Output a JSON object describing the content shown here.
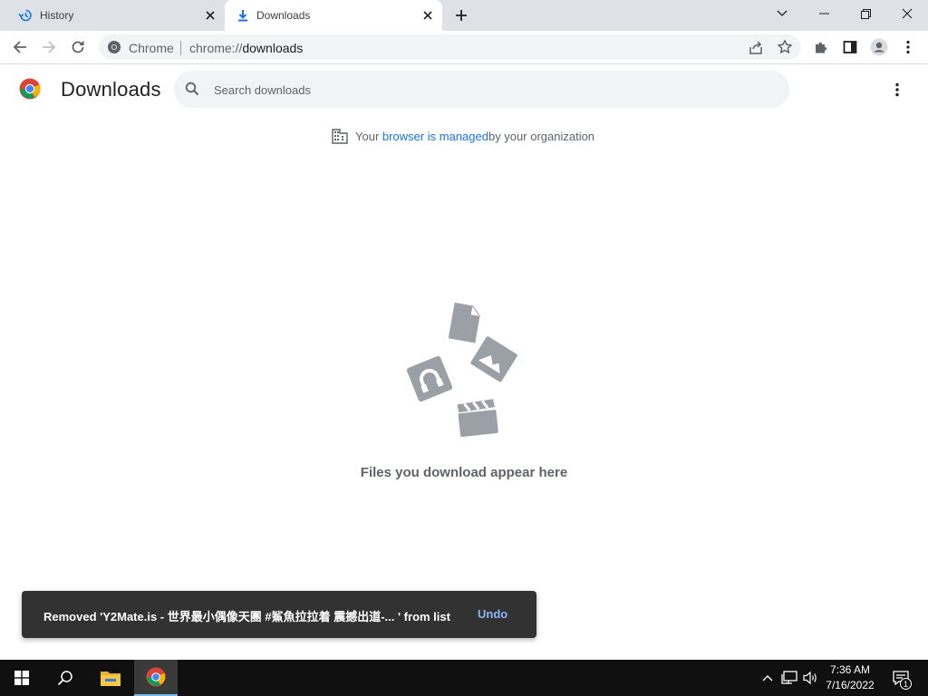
{
  "tabs": [
    {
      "title": "History",
      "icon": "history-icon",
      "active": false
    },
    {
      "title": "Downloads",
      "icon": "download-icon",
      "active": true
    }
  ],
  "toolbar": {
    "site_chip": "Chrome",
    "url_scheme": "chrome://",
    "url_host": "downloads"
  },
  "page": {
    "title": "Downloads",
    "search_placeholder": "Search downloads",
    "managed_prefix": "Your ",
    "managed_link": "browser is managed",
    "managed_suffix": " by your organization",
    "empty_text": "Files you download appear here"
  },
  "toast": {
    "message": "Removed 'Y2Mate.is - 世界最小偶像天團 #鯊魚拉拉着 震撼出道-... ' from list",
    "action": "Undo"
  },
  "taskbar": {
    "time": "7:36 AM",
    "date": "7/16/2022",
    "notification_count": "1"
  },
  "colors": {
    "accent_link": "#1a73e8",
    "toast_bg": "#323232",
    "toast_action": "#8ab4f8",
    "tabstrip_bg": "#dee1e6",
    "taskbar_bg": "#101010"
  }
}
